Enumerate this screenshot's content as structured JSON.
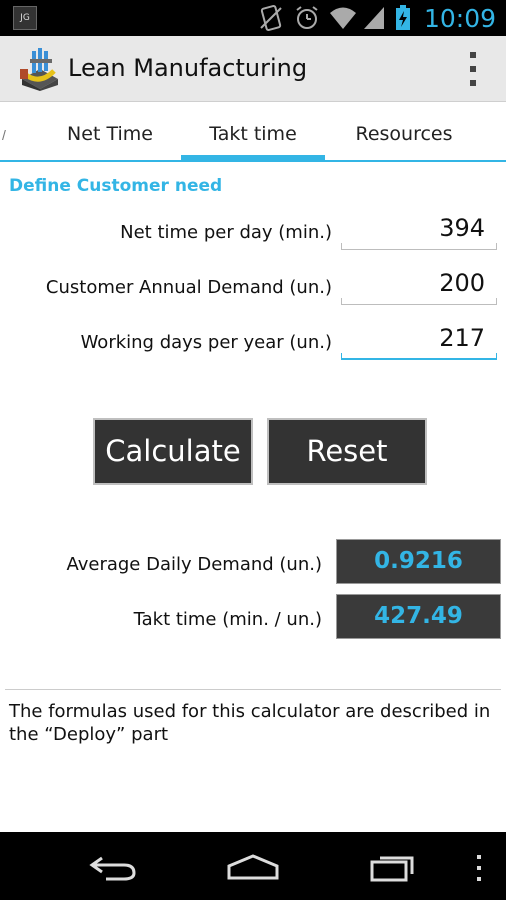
{
  "status_bar": {
    "app_icon_text": "JG",
    "time": "10:09",
    "icons": [
      "no-sim-icon",
      "alarm-icon",
      "wifi-icon",
      "signal-icon",
      "battery-charging-icon"
    ]
  },
  "action_bar": {
    "title": "Lean Manufacturing",
    "logo_icon": "lean-manufacturing-logo",
    "menu_icon": "overflow-menu-icon"
  },
  "tabs": [
    {
      "label": "Net Time",
      "selected": false
    },
    {
      "label": "Takt time",
      "selected": true
    },
    {
      "label": "Resources",
      "selected": false
    }
  ],
  "form": {
    "section_title": "Define Customer need",
    "fields": [
      {
        "label": "Net time per day (min.)",
        "value": "394"
      },
      {
        "label": "Customer Annual Demand (un.)",
        "value": "200"
      },
      {
        "label": "Working days per year (un.)",
        "value": "217"
      }
    ]
  },
  "buttons": {
    "calculate": "Calculate",
    "reset": "Reset"
  },
  "results": [
    {
      "label": "Average Daily Demand (un.)",
      "value": "0.9216"
    },
    {
      "label": "Takt time (min. / un.)",
      "value": "427.49"
    }
  ],
  "footer_note": "The formulas used for this calculator are described in the “Deploy” part",
  "colors": {
    "accent": "#33b5e5",
    "button_bg": "#333333",
    "result_bg": "#3a3a3a",
    "action_bar_bg": "#e8e8e8"
  },
  "nav_bar": {
    "icons": [
      "back-icon",
      "home-icon",
      "recent-apps-icon",
      "menu-dots-icon"
    ]
  }
}
